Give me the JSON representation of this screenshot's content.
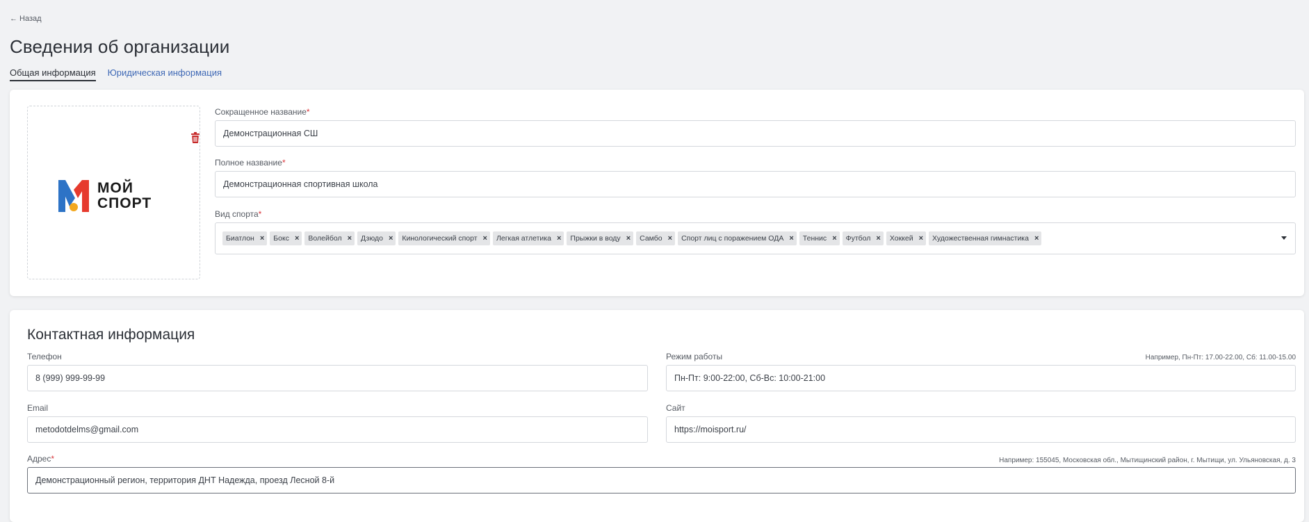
{
  "nav": {
    "back_label": "← Назад"
  },
  "page_title": "Сведения об организации",
  "tabs": [
    {
      "label": "Общая информация",
      "active": true
    },
    {
      "label": "Юридическая информация",
      "active": false
    }
  ],
  "general": {
    "logo": {
      "line1": "МОЙ",
      "line2": "СПОРТ",
      "brand_colors": [
        "#e63a2e",
        "#2d73c6",
        "#f3a81f",
        "#1a1a1a"
      ]
    },
    "short_name": {
      "label": "Сокращенное название",
      "required_mark": "*",
      "value": "Демонстрационная СШ"
    },
    "full_name": {
      "label": "Полное название",
      "required_mark": "*",
      "value": "Демонстрационная спортивная школа"
    },
    "sports": {
      "label": "Вид спорта",
      "required_mark": "*",
      "tags": [
        "Биатлон",
        "Бокс",
        "Волейбол",
        "Дзюдо",
        "Кинологический спорт",
        "Легкая атлетика",
        "Прыжки в воду",
        "Самбо",
        "Спорт лиц с поражением ОДА",
        "Теннис",
        "Футбол",
        "Хоккей",
        "Художественная гимнастика"
      ],
      "remove_glyph": "×"
    }
  },
  "contacts": {
    "title": "Контактная информация",
    "phone": {
      "label": "Телефон",
      "value": "8 (999) 999-99-99"
    },
    "schedule": {
      "label": "Режим работы",
      "hint": "Например, Пн-Пт: 17.00-22.00, Сб: 11.00-15.00",
      "value": "Пн-Пт: 9:00-22:00, Сб-Вс: 10:00-21:00"
    },
    "email": {
      "label": "Email",
      "value": "metodotdelms@gmail.com"
    },
    "site": {
      "label": "Сайт",
      "value": "https://moisport.ru/"
    },
    "address": {
      "label": "Адрес",
      "required_mark": "*",
      "hint": "Например: 155045, Московская обл., Мытищинский район, г. Мытищи, ул. Ульяновская, д. 3",
      "value": "Демонстрационный регион, территория ДНТ Надежда, проезд Лесной 8-й"
    }
  },
  "colors": {
    "accent_link": "#3e68b5",
    "required": "#d9343a",
    "delete_icon": "#c62828"
  }
}
